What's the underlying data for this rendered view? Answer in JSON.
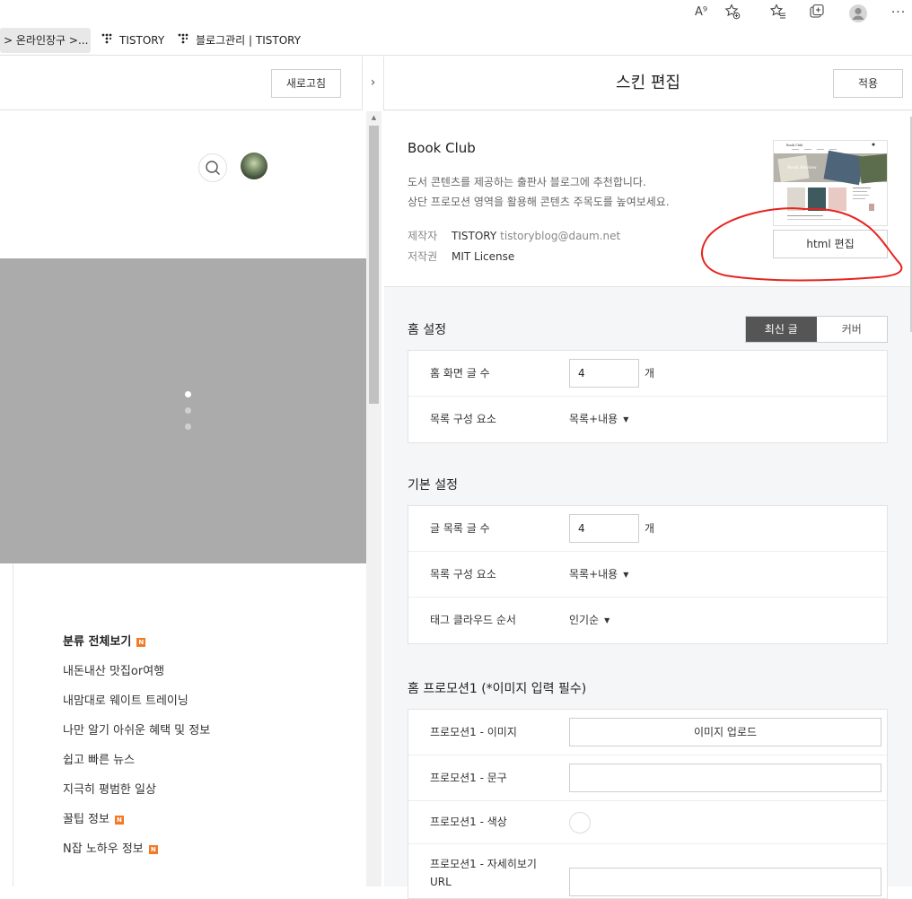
{
  "browser": {
    "toolbar_icons": [
      "read-aloud-icon",
      "add-favorite-icon",
      "favorites-icon",
      "collections-icon",
      "profile-icon",
      "more-icon"
    ],
    "bookmarks": [
      {
        "label": "> 온라인장구 >...",
        "active": true
      },
      {
        "label": "TISTORY",
        "active": false
      },
      {
        "label": "블로그관리 | TISTORY",
        "active": false
      }
    ],
    "read_aloud_glyph": "A⁹"
  },
  "left": {
    "refresh_label": "새로고침",
    "collapse_glyph": "›",
    "categories": [
      {
        "label": "분류 전체보기",
        "bold": true,
        "new": true
      },
      {
        "label": "내돈내산 맛집or여행",
        "bold": false,
        "new": false
      },
      {
        "label": "내맘대로 웨이트 트레이닝",
        "bold": false,
        "new": false
      },
      {
        "label": "나만 알기 아쉬운 혜택 및 정보",
        "bold": false,
        "new": false
      },
      {
        "label": "쉽고 빠른 뉴스",
        "bold": false,
        "new": false
      },
      {
        "label": "지극히 평범한 일상",
        "bold": false,
        "new": false
      },
      {
        "label": "꿀팁 정보",
        "bold": false,
        "new": true
      },
      {
        "label": "N잡 노하우 정보",
        "bold": false,
        "new": true
      }
    ],
    "new_badge": "N"
  },
  "right": {
    "title": "스킨 편집",
    "apply_label": "적용",
    "skin": {
      "name": "Book Club",
      "desc_line1": "도서 콘텐츠를 제공하는 출판사 블로그에 추천합니다.",
      "desc_line2": "상단 프로모션 영역을 활용해 콘텐츠 주목도를 높여보세요.",
      "author_key": "제작자",
      "author_name": "TISTORY",
      "author_email": "tistoryblog@daum.net",
      "license_key": "저작권",
      "license": "MIT License",
      "html_edit_label": "html 편집",
      "thumbnail_caption": "Book Review"
    },
    "home": {
      "title": "홈 설정",
      "tabs": [
        "최신 글",
        "커버"
      ],
      "selected_tab": "최신 글",
      "count_label": "홈 화면 글 수",
      "count_value": "4",
      "count_unit": "개",
      "compose_label": "목록 구성 요소",
      "compose_value": "목록+내용"
    },
    "basic": {
      "title": "기본 설정",
      "count_label": "글 목록 글 수",
      "count_value": "4",
      "count_unit": "개",
      "compose_label": "목록 구성 요소",
      "compose_value": "목록+내용",
      "tag_label": "태그 클라우드 순서",
      "tag_value": "인기순"
    },
    "promo": {
      "title": "홈 프로모션1 (*이미지 입력 필수)",
      "image_label": "프로모션1 - 이미지",
      "upload_label": "이미지 업로드",
      "text_label": "프로모션1 - 문구",
      "text_value": "",
      "color_label": "프로모션1 - 색상",
      "url_label_line1": "프로모션1 - 자세히보기",
      "url_label_line2": "URL",
      "url_value": ""
    }
  },
  "annotation_color": "#e8231e"
}
